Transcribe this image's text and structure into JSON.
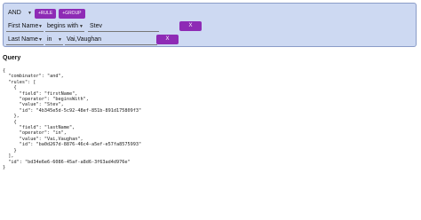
{
  "builder": {
    "combinator": "AND",
    "add_rule_label": "+RULE",
    "add_group_label": "+GROUP",
    "rules": [
      {
        "field": "First Name",
        "operator": "begins with",
        "value": "Stev",
        "remove_label": "X"
      },
      {
        "field": "Last Name",
        "operator": "in",
        "value": "Vai,Vaughan",
        "remove_label": "X"
      }
    ]
  },
  "query": {
    "heading": "Query",
    "json_text": "{\n  \"combinator\": \"and\",\n  \"rules\": [\n    {\n      \"field\": \"firstName\",\n      \"operator\": \"beginsWith\",\n      \"value\": \"Stev\",\n      \"id\": \"4b345e5d-5c92-48ef-851b-891d175809f3\"\n    },\n    {\n      \"field\": \"lastName\",\n      \"operator\": \"in\",\n      \"value\": \"Vai,Vaughan\",\n      \"id\": \"ba0d267d-8876-46c4-a5ef-e57fa8575993\"\n    }\n  ],\n  \"id\": \"bd34e6e6-6086-45af-a8d6-3f63ad4d976e\"\n}"
  }
}
